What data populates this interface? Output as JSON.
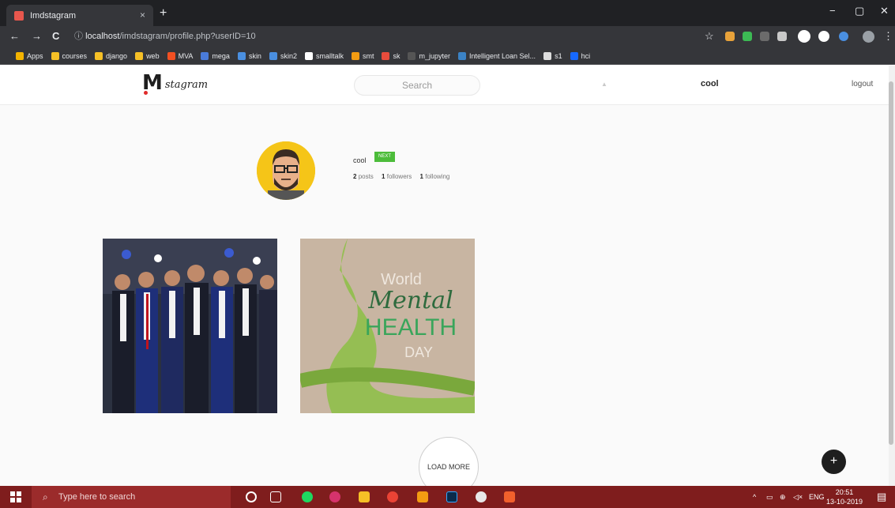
{
  "browser": {
    "tab_title": "Imdstagram",
    "tab_close": "×",
    "new_tab": "+",
    "url_host": "localhost",
    "url_path": "/imdstagram/profile.php?userID=10",
    "window_controls": [
      "−",
      "▢",
      "✕"
    ],
    "nav": {
      "back": "←",
      "forward": "→",
      "reload": "C",
      "info": "ⓘ"
    },
    "bookmarks": [
      {
        "label": "Apps",
        "color": "#f4b400"
      },
      {
        "label": "courses",
        "color": "#f6c026"
      },
      {
        "label": "django",
        "color": "#f6c026"
      },
      {
        "label": "web",
        "color": "#f6c026"
      },
      {
        "label": "MVA",
        "color": "#f25022"
      },
      {
        "label": "mega",
        "color": "#4a7bd9"
      },
      {
        "label": "skin",
        "color": "#4a8fe0"
      },
      {
        "label": "skin2",
        "color": "#4a8fe0"
      },
      {
        "label": "smalltalk",
        "color": "#ffffff"
      },
      {
        "label": "smt",
        "color": "#f39c12"
      },
      {
        "label": "sk",
        "color": "#e74c3c"
      },
      {
        "label": "m_jupyter",
        "color": "#555555"
      },
      {
        "label": "Intelligent Loan Sel...",
        "color": "#3b82c4"
      },
      {
        "label": "s1",
        "color": "#dddddd"
      },
      {
        "label": "hci",
        "color": "#1769ff"
      }
    ]
  },
  "site": {
    "logo_word": "stagram",
    "logo_letter": "M",
    "search_placeholder": "Search",
    "bell_icon": "▲",
    "username": "cool",
    "logout_label": "logout"
  },
  "profile": {
    "name": "cool",
    "badge": "NEXT",
    "posts_count": "2",
    "posts_label": "posts",
    "followers_count": "1",
    "followers_label": "followers",
    "following_count": "1",
    "following_label": "following"
  },
  "posts": [
    {
      "kind": "group-photo"
    },
    {
      "kind": "poster",
      "line1": "World",
      "line2": "Mental",
      "line3": "HEALTH",
      "line4": "DAY",
      "accent": "#3aa55b"
    }
  ],
  "load_more_label": "LOAD MORE",
  "fab_label": "+",
  "taskbar": {
    "search_text": "Type here to search",
    "tray_lang": "ENG",
    "time": "20:51",
    "date": "13-10-2019",
    "tray_caret": "^"
  },
  "colors": {
    "accent_green": "#4cbc3a",
    "avatar_bg": "#f5c518",
    "taskbar_bg": "#7f1d1d"
  }
}
